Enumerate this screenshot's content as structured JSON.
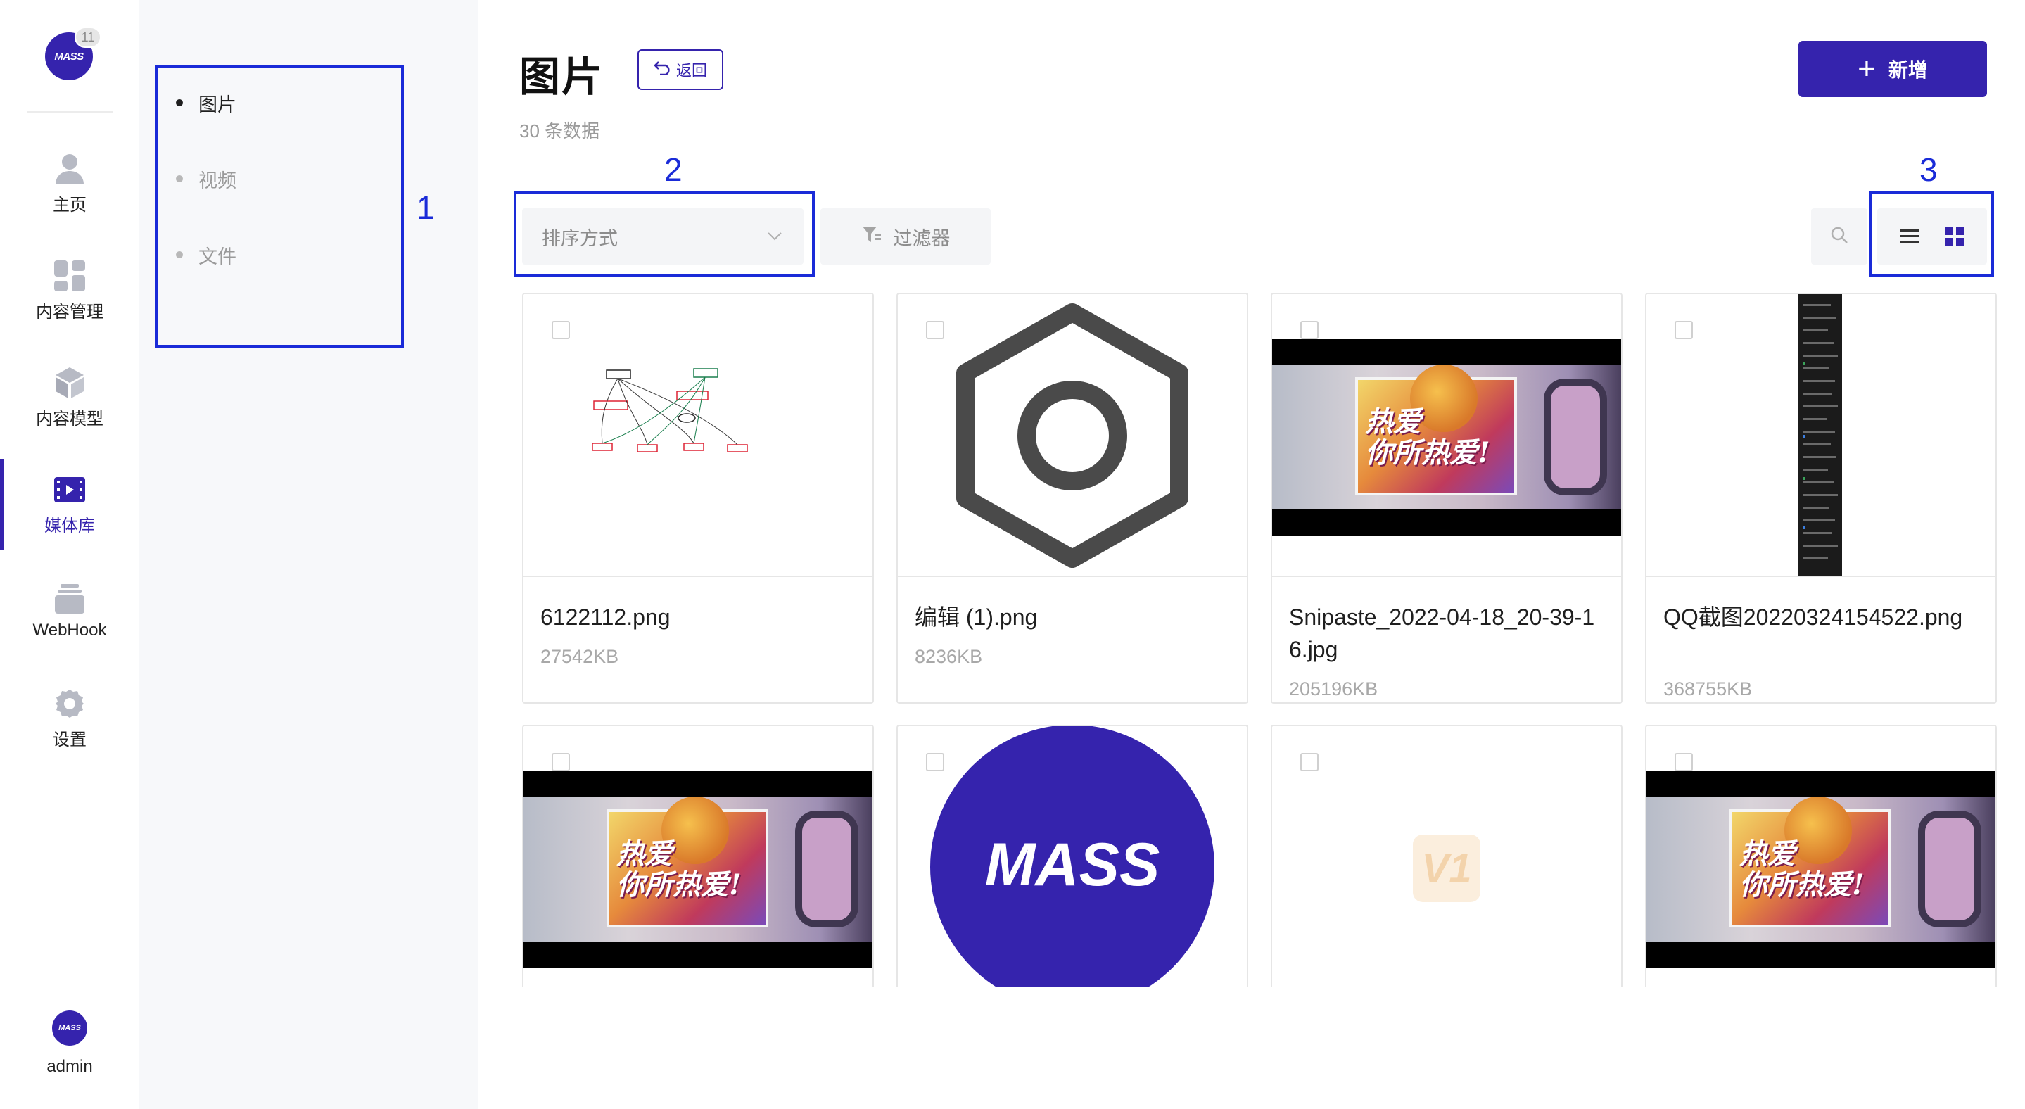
{
  "app": {
    "logo_text": "MASS",
    "logo_badge": "11",
    "brand_color": "#3523ad",
    "annotation_color": "#1a2bd8"
  },
  "rail": {
    "items": [
      {
        "label": "主页",
        "icon": "user-icon"
      },
      {
        "label": "内容管理",
        "icon": "dashboard-icon"
      },
      {
        "label": "内容模型",
        "icon": "cube-icon"
      },
      {
        "label": "媒体库",
        "icon": "film-icon",
        "active": true
      },
      {
        "label": "WebHook",
        "icon": "stack-icon"
      },
      {
        "label": "设置",
        "icon": "gear-icon"
      }
    ],
    "user": {
      "avatar_text": "MASS",
      "name": "admin"
    }
  },
  "subnav": {
    "items": [
      {
        "label": "图片",
        "active": true
      },
      {
        "label": "视频"
      },
      {
        "label": "文件"
      }
    ]
  },
  "annotations": [
    "1",
    "2",
    "3"
  ],
  "header": {
    "title": "图片",
    "back_label": "返回",
    "count_text": "30 条数据",
    "add_label": "新增"
  },
  "toolbar": {
    "sort_placeholder": "排序方式",
    "filter_label": "过滤器"
  },
  "cards": [
    {
      "name": "6122112.png",
      "size": "27542KB",
      "thumb": "diagram"
    },
    {
      "name": "编辑 (1).png",
      "size": "8236KB",
      "thumb": "hex-icon"
    },
    {
      "name": "Snipaste_2022-04-18_20-39-16.jpg",
      "size": "205196KB",
      "thumb": "video"
    },
    {
      "name": "QQ截图20220324154522.png",
      "size": "368755KB",
      "thumb": "screenshot"
    },
    {
      "name": "",
      "size": "",
      "thumb": "video"
    },
    {
      "name": "",
      "size": "",
      "thumb": "mass-logo",
      "logo_text": "MASS"
    },
    {
      "name": "",
      "size": "",
      "thumb": "v1-logo",
      "logo_text": "V1"
    },
    {
      "name": "",
      "size": "",
      "thumb": "video"
    }
  ],
  "video_slogan": "热爱\n你所热爱!"
}
